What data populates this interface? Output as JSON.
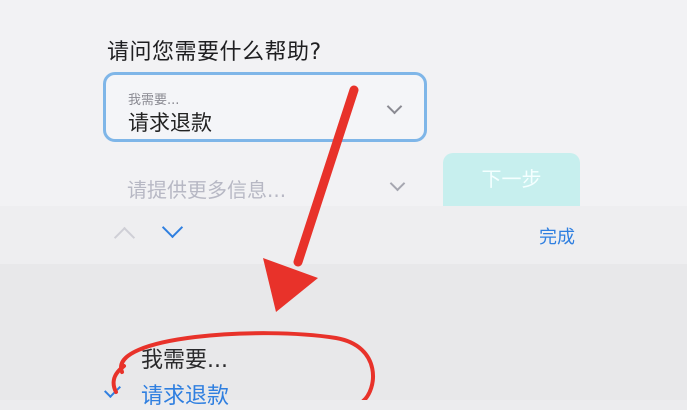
{
  "form": {
    "question": "请问您需要什么帮助?",
    "select": {
      "label": "我需要...",
      "value": "请求退款",
      "icon": "chevron-down-icon"
    },
    "info_field": {
      "placeholder": "请提供更多信息...",
      "icon": "chevron-down-icon"
    },
    "next_button": "下一步"
  },
  "keyboard_toolbar": {
    "prev_icon": "chevron-up-icon",
    "next_icon": "chevron-down-icon",
    "done": "完成"
  },
  "picker": {
    "header": "我需要...",
    "selected": "请求退款",
    "selected_icon": "checkmark-icon"
  },
  "annotation": {
    "arrow_color": "#e8322a",
    "circle_color": "#e8322a"
  },
  "colors": {
    "accent": "#2f7fe0",
    "focus_border": "#7fb6e8",
    "button_disabled": "#c7efee"
  }
}
